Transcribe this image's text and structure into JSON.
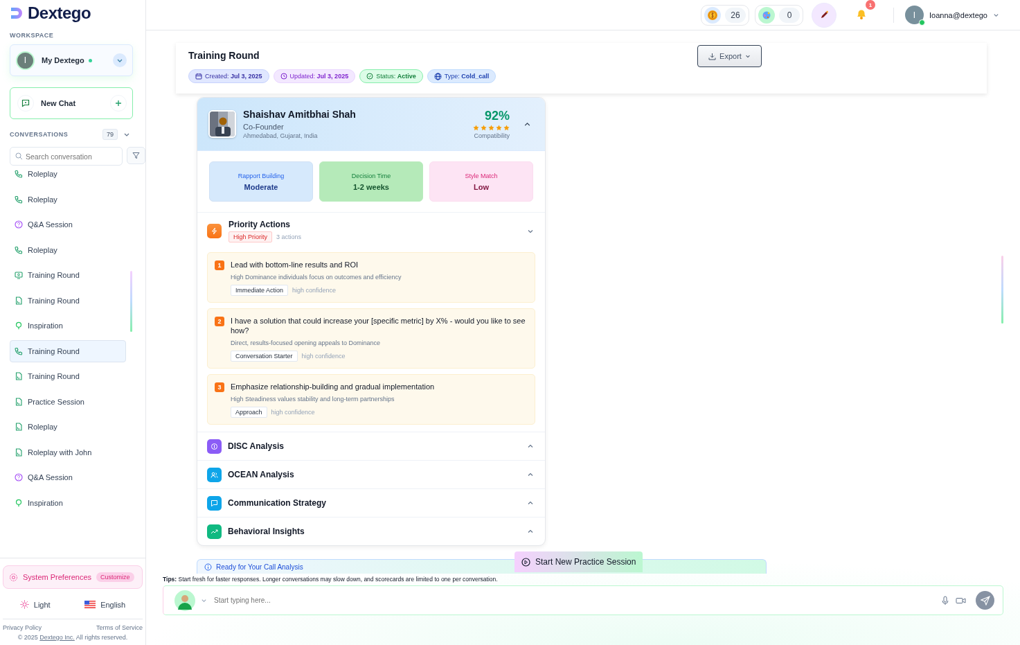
{
  "brand": {
    "name": "Dextego"
  },
  "workspace": {
    "label": "WORKSPACE",
    "name": "My Dextego",
    "avatar_letter": "I"
  },
  "new_chat": {
    "label": "New Chat"
  },
  "conversations": {
    "label": "CONVERSATIONS",
    "count": "79",
    "search_placeholder": "Search conversation",
    "items": [
      {
        "title": "Roleplay",
        "kind": "call",
        "selected": false
      },
      {
        "title": "Roleplay",
        "kind": "call",
        "selected": false
      },
      {
        "title": "Q&A Session",
        "kind": "question",
        "selected": false
      },
      {
        "title": "Roleplay",
        "kind": "call",
        "selected": false
      },
      {
        "title": "Training Round",
        "kind": "screen",
        "selected": false
      },
      {
        "title": "Training Round",
        "kind": "document",
        "selected": false
      },
      {
        "title": "Inspiration",
        "kind": "idea",
        "selected": false
      },
      {
        "title": "Training Round",
        "kind": "call",
        "selected": true
      },
      {
        "title": "Training Round",
        "kind": "document",
        "selected": false
      },
      {
        "title": "Practice Session",
        "kind": "document",
        "selected": false
      },
      {
        "title": "Roleplay",
        "kind": "document",
        "selected": false
      },
      {
        "title": "Roleplay with John",
        "kind": "document",
        "selected": false
      },
      {
        "title": "Q&A Session",
        "kind": "question",
        "selected": false
      },
      {
        "title": "Inspiration",
        "kind": "idea",
        "selected": false
      }
    ]
  },
  "preferences": {
    "label": "System Preferences",
    "badge": "Customize",
    "theme": "Light",
    "language": "English"
  },
  "footer": {
    "privacy": "Privacy Policy",
    "terms": "Terms of Service",
    "copyright_before": "© 2025",
    "company": "Dextego Inc.",
    "copyright_after": "All rights reserved."
  },
  "topbar": {
    "coins": "26",
    "rewards": "0",
    "notifications": "1",
    "user": "Ioanna@dextego",
    "avatar_letter": "I"
  },
  "header": {
    "title": "Training Round",
    "export": "Export",
    "chips": [
      {
        "label": "Created:",
        "value": "Jul 3, 2025",
        "kind": "calendar"
      },
      {
        "label": "Updated:",
        "value": "Jul 3, 2025",
        "kind": "clock"
      },
      {
        "label": "Status:",
        "value": "Active",
        "kind": "status"
      },
      {
        "label": "Type:",
        "value": "Cold_call",
        "kind": "globe"
      }
    ]
  },
  "profile": {
    "name": "Shaishav Amitbhai Shah",
    "role": "Co-Founder",
    "location": "Ahmedabad, Gujarat, India",
    "score": "92%",
    "stars": 5,
    "score_label": "Compatibility",
    "metrics": [
      {
        "label": "Rapport Building",
        "value": "Moderate",
        "kind": "blue"
      },
      {
        "label": "Decision Time",
        "value": "1-2 weeks",
        "kind": "green"
      },
      {
        "label": "Style Match",
        "value": "Low",
        "kind": "pink"
      }
    ]
  },
  "priority": {
    "title": "Priority Actions",
    "badge": "High Priority",
    "count": "3 actions",
    "expanded": true,
    "actions": [
      {
        "number": "1",
        "title": "Lead with bottom-line results and ROI",
        "reason": "High Dominance individuals focus on outcomes and efficiency",
        "tag": "Immediate Action",
        "confidence": "high confidence"
      },
      {
        "number": "2",
        "title": "I have a solution that could increase your [specific metric] by X% - would you like to see how?",
        "reason": "Direct, results-focused opening appeals to Dominance",
        "tag": "Conversation Starter",
        "confidence": "high confidence"
      },
      {
        "number": "3",
        "title": "Emphasize relationship-building and gradual implementation",
        "reason": "High Steadiness values stability and long-term partnerships",
        "tag": "Approach",
        "confidence": "high confidence"
      }
    ]
  },
  "sections": [
    {
      "title": "DISC Analysis",
      "kind": "disc",
      "expanded": false
    },
    {
      "title": "OCEAN Analysis",
      "kind": "people",
      "expanded": false
    },
    {
      "title": "Communication Strategy",
      "kind": "chat",
      "expanded": false
    },
    {
      "title": "Behavioral Insights",
      "kind": "trend",
      "expanded": false
    }
  ],
  "banner": {
    "text": "Ready for Your Call Analysis",
    "button": "Start New Practice Session"
  },
  "tips": {
    "label": "Tips:",
    "text": "Start fresh for faster responses. Longer conversations may slow down, and scorecards are limited to one per conversation."
  },
  "composer": {
    "placeholder": "Start typing here..."
  }
}
